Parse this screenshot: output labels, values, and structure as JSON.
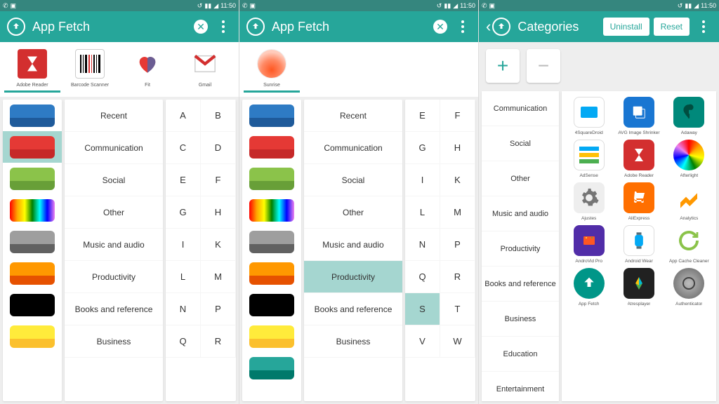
{
  "statusbar": {
    "time": "11:50"
  },
  "panel1": {
    "title": "App Fetch",
    "apps": [
      {
        "name": "Adobe Reader",
        "color": "#d32f2f"
      },
      {
        "name": "Barcode Scanner",
        "color": "#fff"
      },
      {
        "name": "Fit",
        "color": "#fff"
      },
      {
        "name": "Gmail",
        "color": "#fff"
      }
    ],
    "categories": [
      "Recent",
      "Communication",
      "Social",
      "Other",
      "Music and audio",
      "Productivity",
      "Books and reference",
      "Business"
    ],
    "selectedColorIdx": 1,
    "alpha": [
      [
        "A",
        "B"
      ],
      [
        "C",
        "D"
      ],
      [
        "E",
        "F"
      ],
      [
        "G",
        "H"
      ],
      [
        "I",
        "K"
      ],
      [
        "L",
        "M"
      ],
      [
        "N",
        "P"
      ],
      [
        "Q",
        "R"
      ]
    ]
  },
  "panel2": {
    "title": "App Fetch",
    "apps": [
      {
        "name": "Sunrise",
        "color": "#fff"
      }
    ],
    "categories": [
      "Recent",
      "Communication",
      "Social",
      "Other",
      "Music and audio",
      "Productivity",
      "Books and reference",
      "Business"
    ],
    "selectedCatIdx": 5,
    "selectedAlpha": "S",
    "alpha": [
      [
        "E",
        "F"
      ],
      [
        "G",
        "H"
      ],
      [
        "I",
        "K"
      ],
      [
        "L",
        "M"
      ],
      [
        "N",
        "P"
      ],
      [
        "Q",
        "R"
      ],
      [
        "S",
        "T"
      ],
      [
        "V",
        "W"
      ]
    ]
  },
  "panel3": {
    "title": "Categories",
    "uninstall": "Uninstall",
    "reset": "Reset",
    "categories": [
      "Communication",
      "Social",
      "Other",
      "Music and audio",
      "Productivity",
      "Books and reference",
      "Business",
      "Education",
      "Entertainment"
    ],
    "apps": [
      {
        "name": "4SquareDroid",
        "bg": "#fff"
      },
      {
        "name": "AVG Image Shrinker",
        "bg": "#1976d2"
      },
      {
        "name": "Adaway",
        "bg": "#00897b"
      },
      {
        "name": "AdSense",
        "bg": "#fff"
      },
      {
        "name": "Adobe Reader",
        "bg": "#d32f2f"
      },
      {
        "name": "Afterlight",
        "bg": "#fff"
      },
      {
        "name": "Ajustes",
        "bg": "#eee"
      },
      {
        "name": "AliExpress",
        "bg": "#ff6f00"
      },
      {
        "name": "Analytics",
        "bg": "#fff"
      },
      {
        "name": "AndroVid Pro",
        "bg": "#673ab7"
      },
      {
        "name": "Android Wear",
        "bg": "#fff"
      },
      {
        "name": "App Cache Cleaner",
        "bg": "#fff"
      },
      {
        "name": "App Fetch",
        "bg": "#009688"
      },
      {
        "name": "Atresplayer",
        "bg": "#212121"
      },
      {
        "name": "Authenticator",
        "bg": "#9e9e9e"
      }
    ]
  }
}
